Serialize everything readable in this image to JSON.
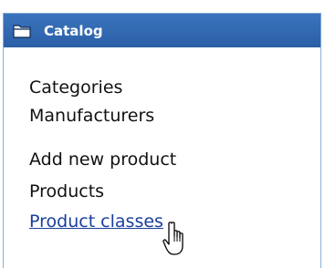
{
  "panel": {
    "title": "Catalog",
    "icon": "folder-icon",
    "header_color": "#2f66ad",
    "link_color": "#1a3e9c"
  },
  "menu": {
    "groups": [
      {
        "items": [
          {
            "label": "Categories"
          },
          {
            "label": "Manufacturers"
          }
        ]
      },
      {
        "items": [
          {
            "label": "Add new product"
          },
          {
            "label": "Products"
          },
          {
            "label": "Product classes",
            "hovered": true
          }
        ]
      }
    ]
  },
  "cursor": {
    "icon": "hand-pointer-icon"
  }
}
